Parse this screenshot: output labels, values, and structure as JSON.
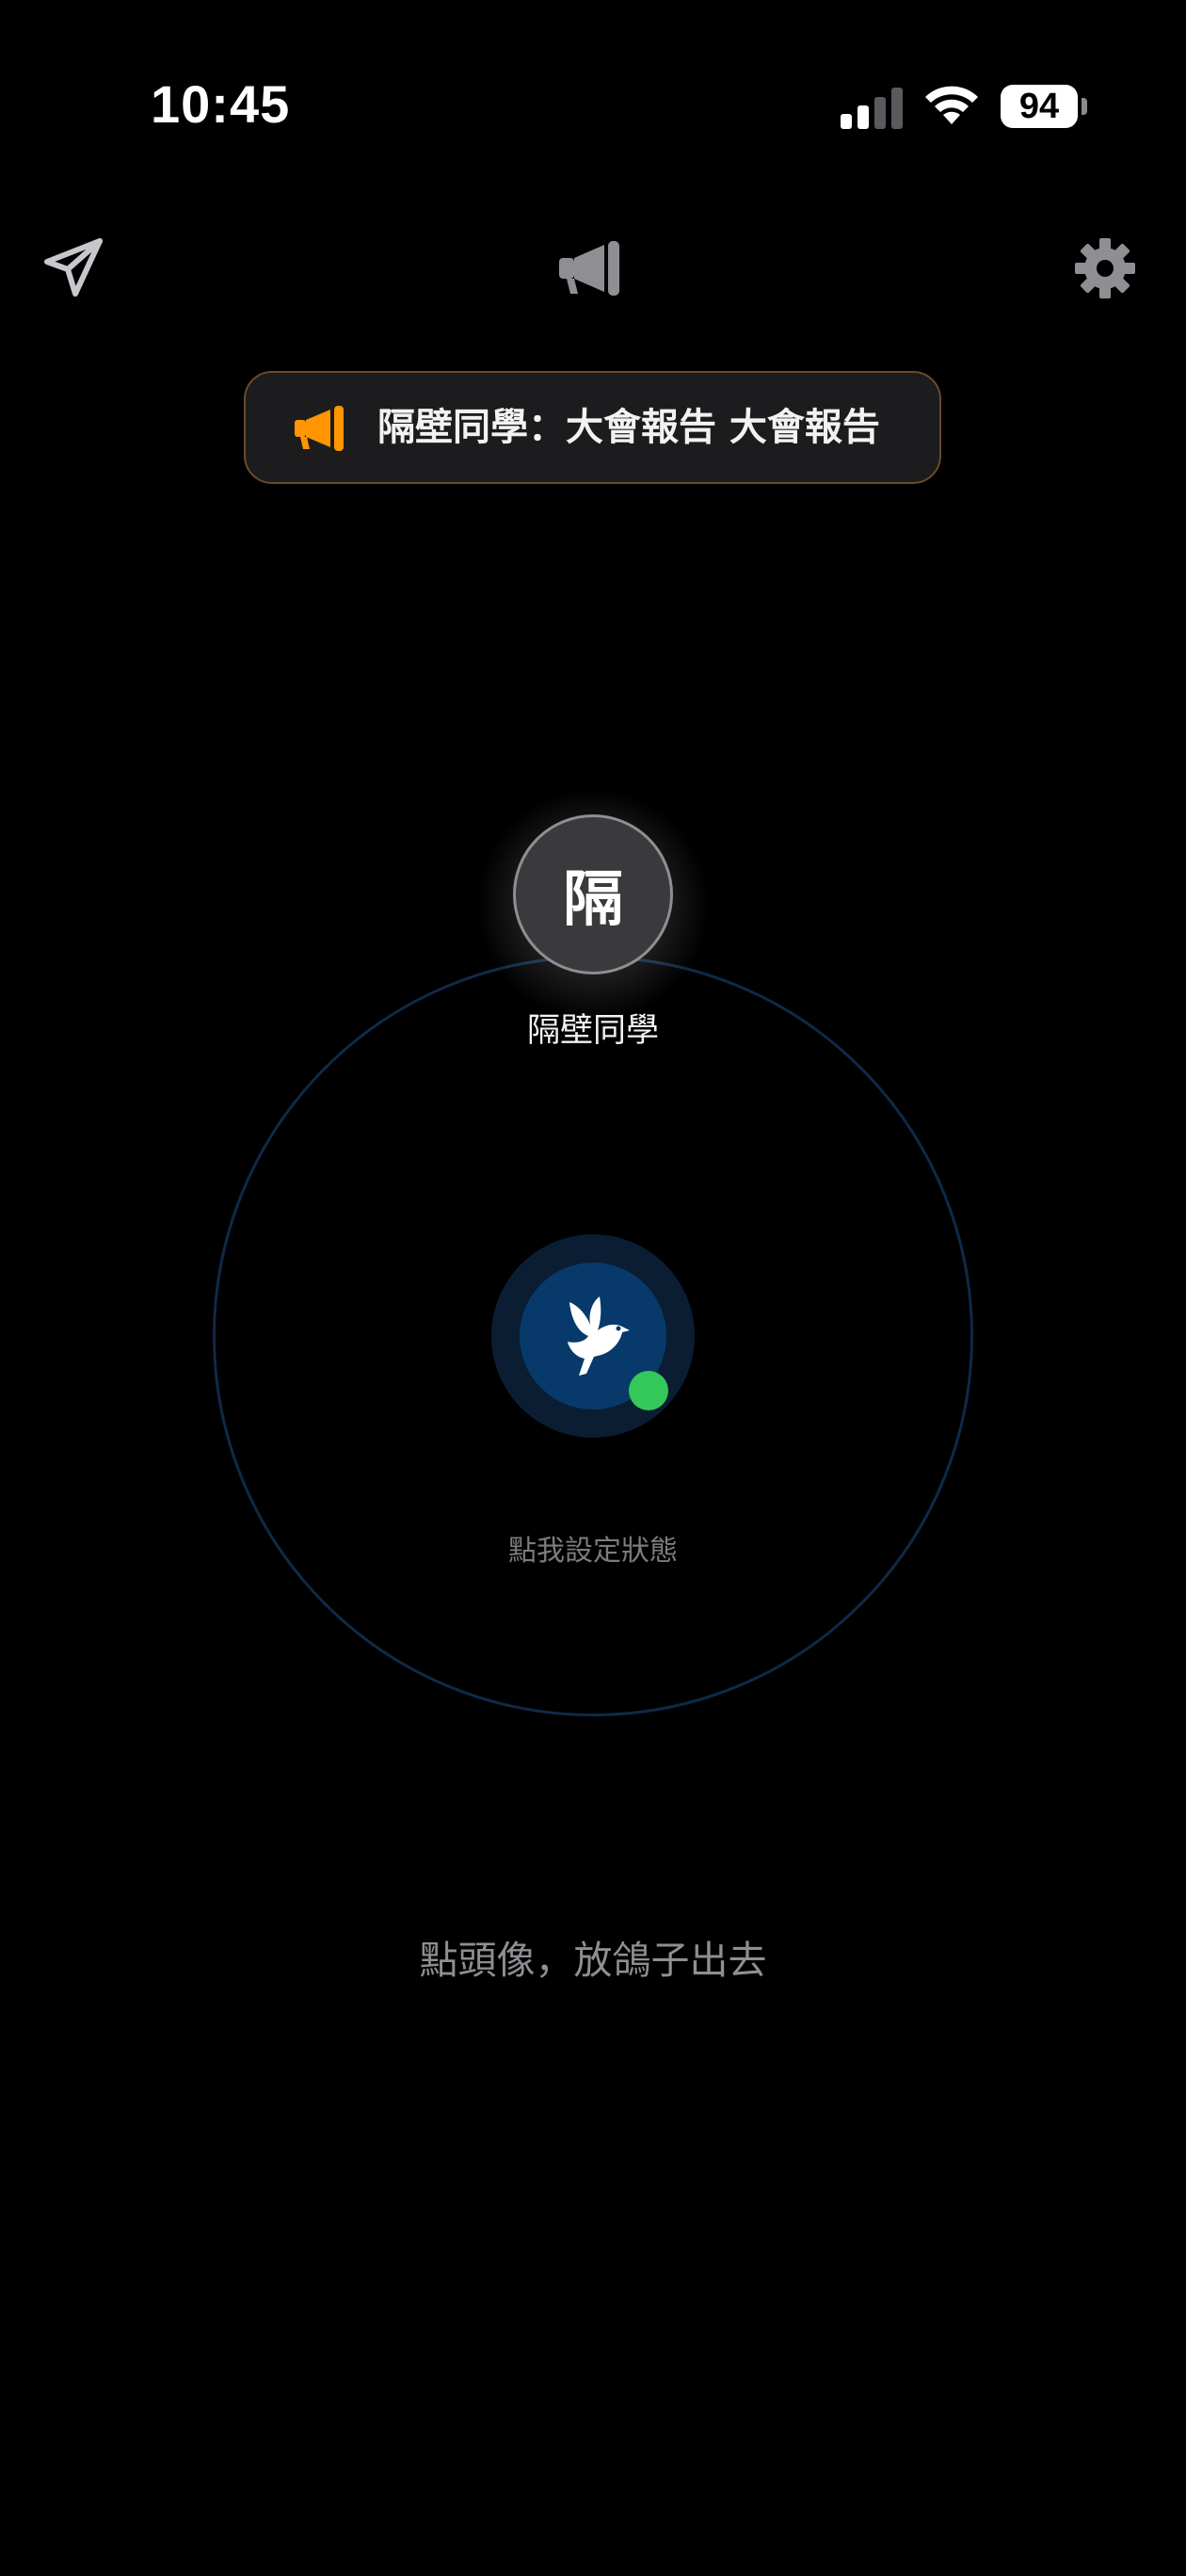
{
  "status_bar": {
    "time": "10:45",
    "battery": "94"
  },
  "toolbar": {
    "send_icon": "paper-plane-icon",
    "announce_icon": "megaphone-icon",
    "settings_icon": "gear-icon"
  },
  "announcement": {
    "icon": "megaphone-icon",
    "text": "隔壁同學：大會報告 大會報告",
    "icon_color": "#ff9500",
    "border_color": "#6b4a26"
  },
  "contact": {
    "initial": "隔",
    "name": "隔壁同學"
  },
  "center": {
    "icon": "pigeon-icon",
    "status_color": "#34c759",
    "set_status_label": "點我設定狀態"
  },
  "hint": "點頭像，放鴿子出去"
}
